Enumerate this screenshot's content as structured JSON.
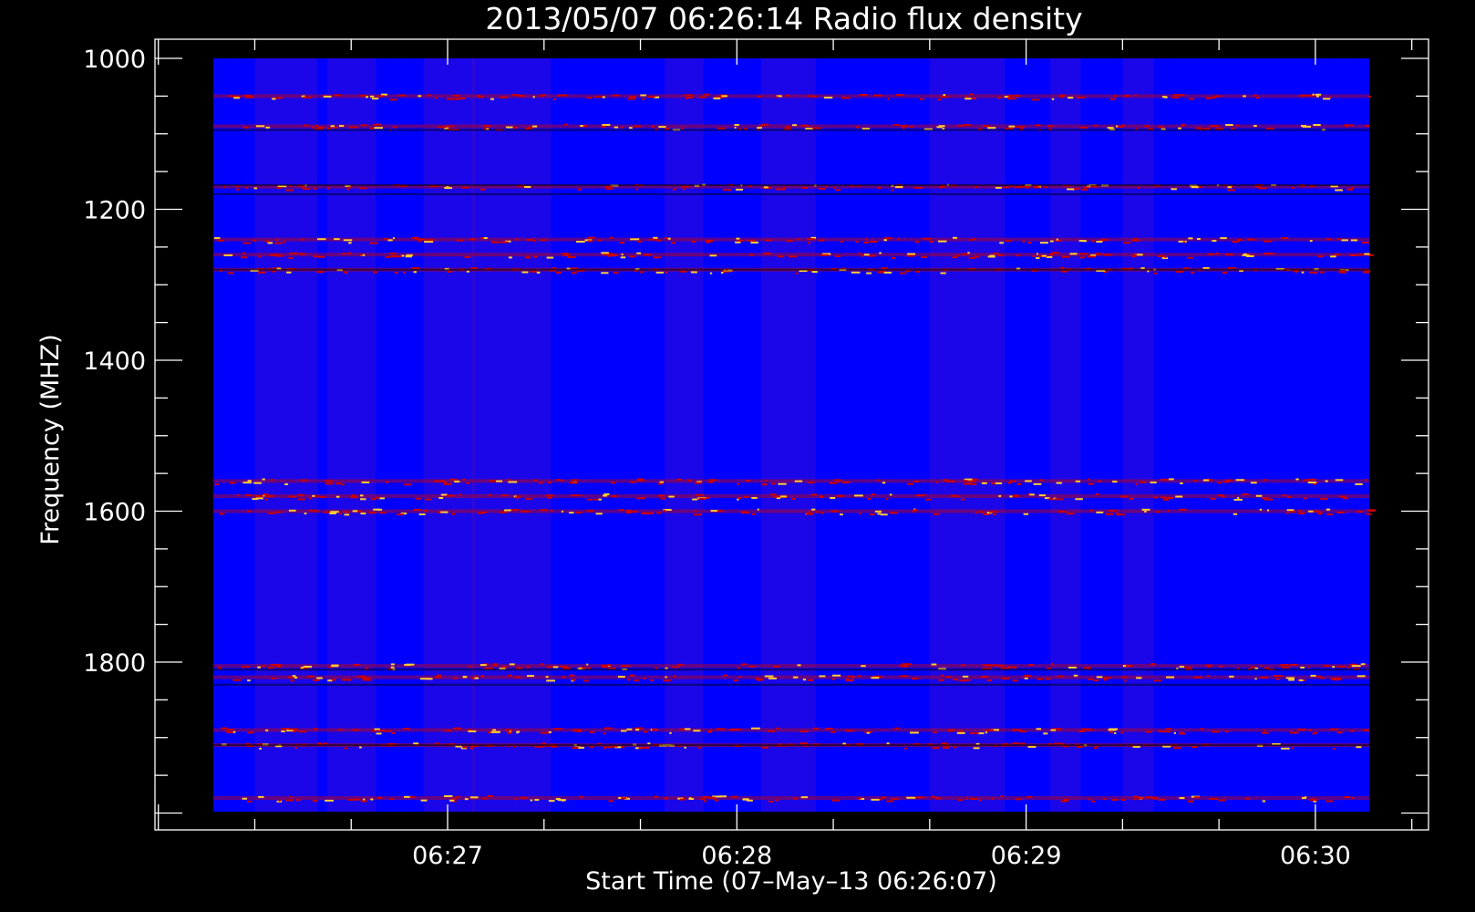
{
  "chart_data": {
    "type": "heatmap",
    "title": "2013/05/07 06:26:14 Radio flux density",
    "xlabel": "Start Time (07–May–13 06:26:07)",
    "ylabel": "Frequency (MHZ)",
    "x_major_ticks": [
      "06:27",
      "06:28",
      "06:29",
      "06:30"
    ],
    "y_major_ticks": [
      "1000",
      "1200",
      "1400",
      "1600",
      "1800"
    ],
    "ylim": [
      1000,
      2000
    ],
    "y_axis_inverted": true,
    "grid": false,
    "colors": {
      "background": "#000000",
      "axis": "#ffffff",
      "low": "#0000ff",
      "mid": "#cc0000",
      "high": "#ffcc33",
      "void": "#000000"
    },
    "features": {
      "bright_bands_mhz": [
        1050,
        1090,
        1170,
        1240,
        1260,
        1280,
        1560,
        1580,
        1600,
        1805,
        1820,
        1890,
        1910,
        1980
      ],
      "dark_bands_mhz": [
        1095,
        1168,
        1180,
        1280,
        1810,
        1830,
        1910
      ],
      "active_time_columns": [
        "06:26:20",
        "06:26:35",
        "06:26:55",
        "06:27:05",
        "06:27:45",
        "06:28:05",
        "06:28:40",
        "06:29:05",
        "06:29:20"
      ]
    }
  }
}
